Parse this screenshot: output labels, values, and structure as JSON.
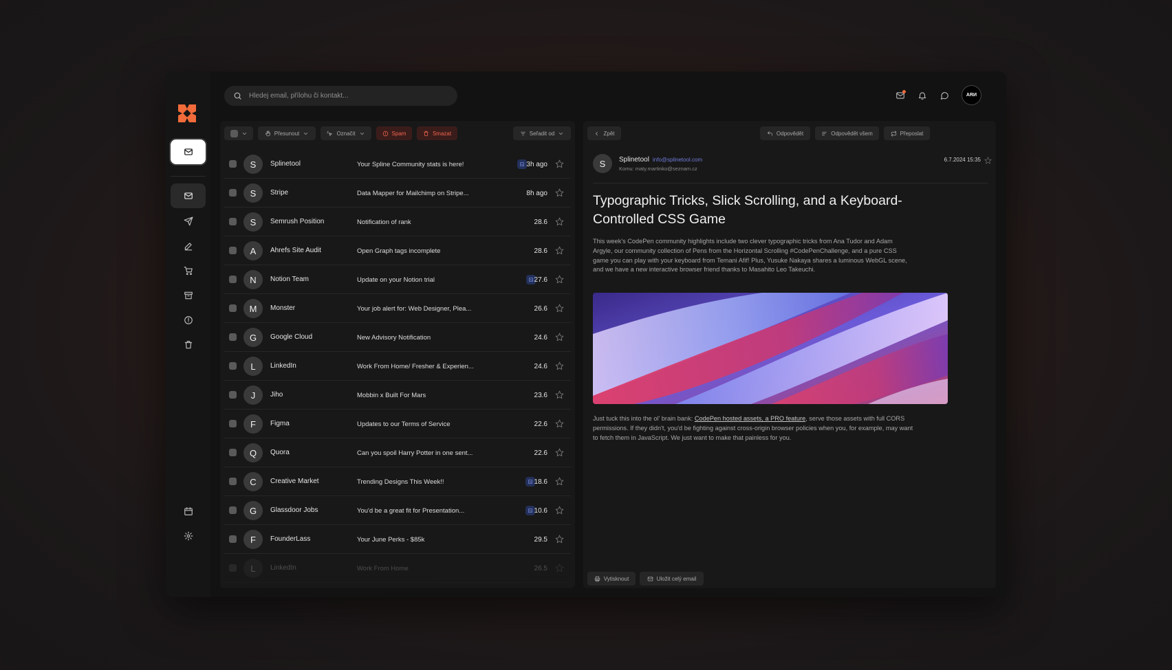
{
  "search": {
    "placeholder": "Hledej email, přílohu či kontakt..."
  },
  "user": {
    "initials": "ARИ"
  },
  "toolbar": {
    "move_label": "Přesunout",
    "mark_label": "Označit",
    "spam_label": "Spam",
    "delete_label": "Smazat",
    "sort_label": "Seřadit od"
  },
  "emails": [
    {
      "initial": "S",
      "sender": "Splinetool",
      "subject": "Your Spline Community stats is here!",
      "date": "3h ago",
      "attachment": true
    },
    {
      "initial": "S",
      "sender": "Stripe",
      "subject": "Data Mapper for Mailchimp on Stripe...",
      "date": "8h ago",
      "attachment": false
    },
    {
      "initial": "S",
      "sender": "Semrush Position",
      "subject": "Notification of rank",
      "date": "28.6",
      "attachment": false
    },
    {
      "initial": "A",
      "sender": "Ahrefs Site Audit",
      "subject": "Open Graph tags incomplete",
      "date": "28.6",
      "attachment": false
    },
    {
      "initial": "N",
      "sender": "Notion Team",
      "subject": "Update on your Notion trial",
      "date": "27.6",
      "attachment": true
    },
    {
      "initial": "M",
      "sender": "Monster",
      "subject": "Your job alert for: Web Designer, Plea...",
      "date": "26.6",
      "attachment": false
    },
    {
      "initial": "G",
      "sender": "Google Cloud",
      "subject": "New Advisory Notification",
      "date": "24.6",
      "attachment": false
    },
    {
      "initial": "L",
      "sender": "LinkedIn",
      "subject": "Work From Home/ Fresher & Experien...",
      "date": "24.6",
      "attachment": false
    },
    {
      "initial": "J",
      "sender": "Jiho",
      "subject": "Mobbin x Built For Mars",
      "date": "23.6",
      "attachment": false
    },
    {
      "initial": "F",
      "sender": "Figma",
      "subject": "Updates to our Terms of Service",
      "date": "22.6",
      "attachment": false
    },
    {
      "initial": "Q",
      "sender": "Quora",
      "subject": "Can you spoil Harry Potter in one sent...",
      "date": "22.6",
      "attachment": false
    },
    {
      "initial": "C",
      "sender": "Creative Market",
      "subject": "Trending Designs This Week!!",
      "date": "18.6",
      "attachment": true
    },
    {
      "initial": "G",
      "sender": "Glassdoor Jobs",
      "subject": "You'd be a great fit for Presentation...",
      "date": "10.6",
      "attachment": true
    },
    {
      "initial": "F",
      "sender": "FounderLass",
      "subject": "Your June Perks - $85k",
      "date": "29.5",
      "attachment": false
    },
    {
      "initial": "L",
      "sender": "LinkedIn",
      "subject": "Work From Home",
      "date": "26.5",
      "attachment": false
    }
  ],
  "reader": {
    "back_label": "Zpět",
    "reply_label": "Odpovědět",
    "reply_all_label": "Odpovědět všem",
    "forward_label": "Přeposlat",
    "from_initial": "S",
    "from_name": "Splinetool",
    "from_email": "info@splinetool.com",
    "to_line": "Komu: maty.martinko@seznam.cz",
    "date": "6.7.2024 15:35",
    "title": "Typographic Tricks, Slick Scrolling, and a Keyboard-Controlled CSS Game",
    "body": "This week's CodePen community highlights include two clever typographic tricks from Ana Tudor and Adam Argyle, our community collection of Pens from the Horizontal Scrolling #CodePenChallenge, and a pure CSS game you can play with your keyboard from Temani Afif! Plus, Yusuke Nakaya shares a luminous WebGL scene, and we have a new interactive browser friend thanks to Masahito Leo Takeuchi.",
    "body2_pre": "Just tuck this into the ol' brain bank: ",
    "body2_link": "CodePen hosted assets, a PRO feature",
    "body2_post": ", serve those assets with full CORS permissions. If they didn't, you'd be fighting against cross-origin browser policies when you, for example, may want to fetch them in JavaScript. We just want to make that painless for you.",
    "print_label": "Vytisknout",
    "save_label": "Uložit celý email"
  },
  "colors": {
    "accent": "#f26b3a",
    "danger": "#f0644d",
    "link": "#6f7cd9"
  }
}
